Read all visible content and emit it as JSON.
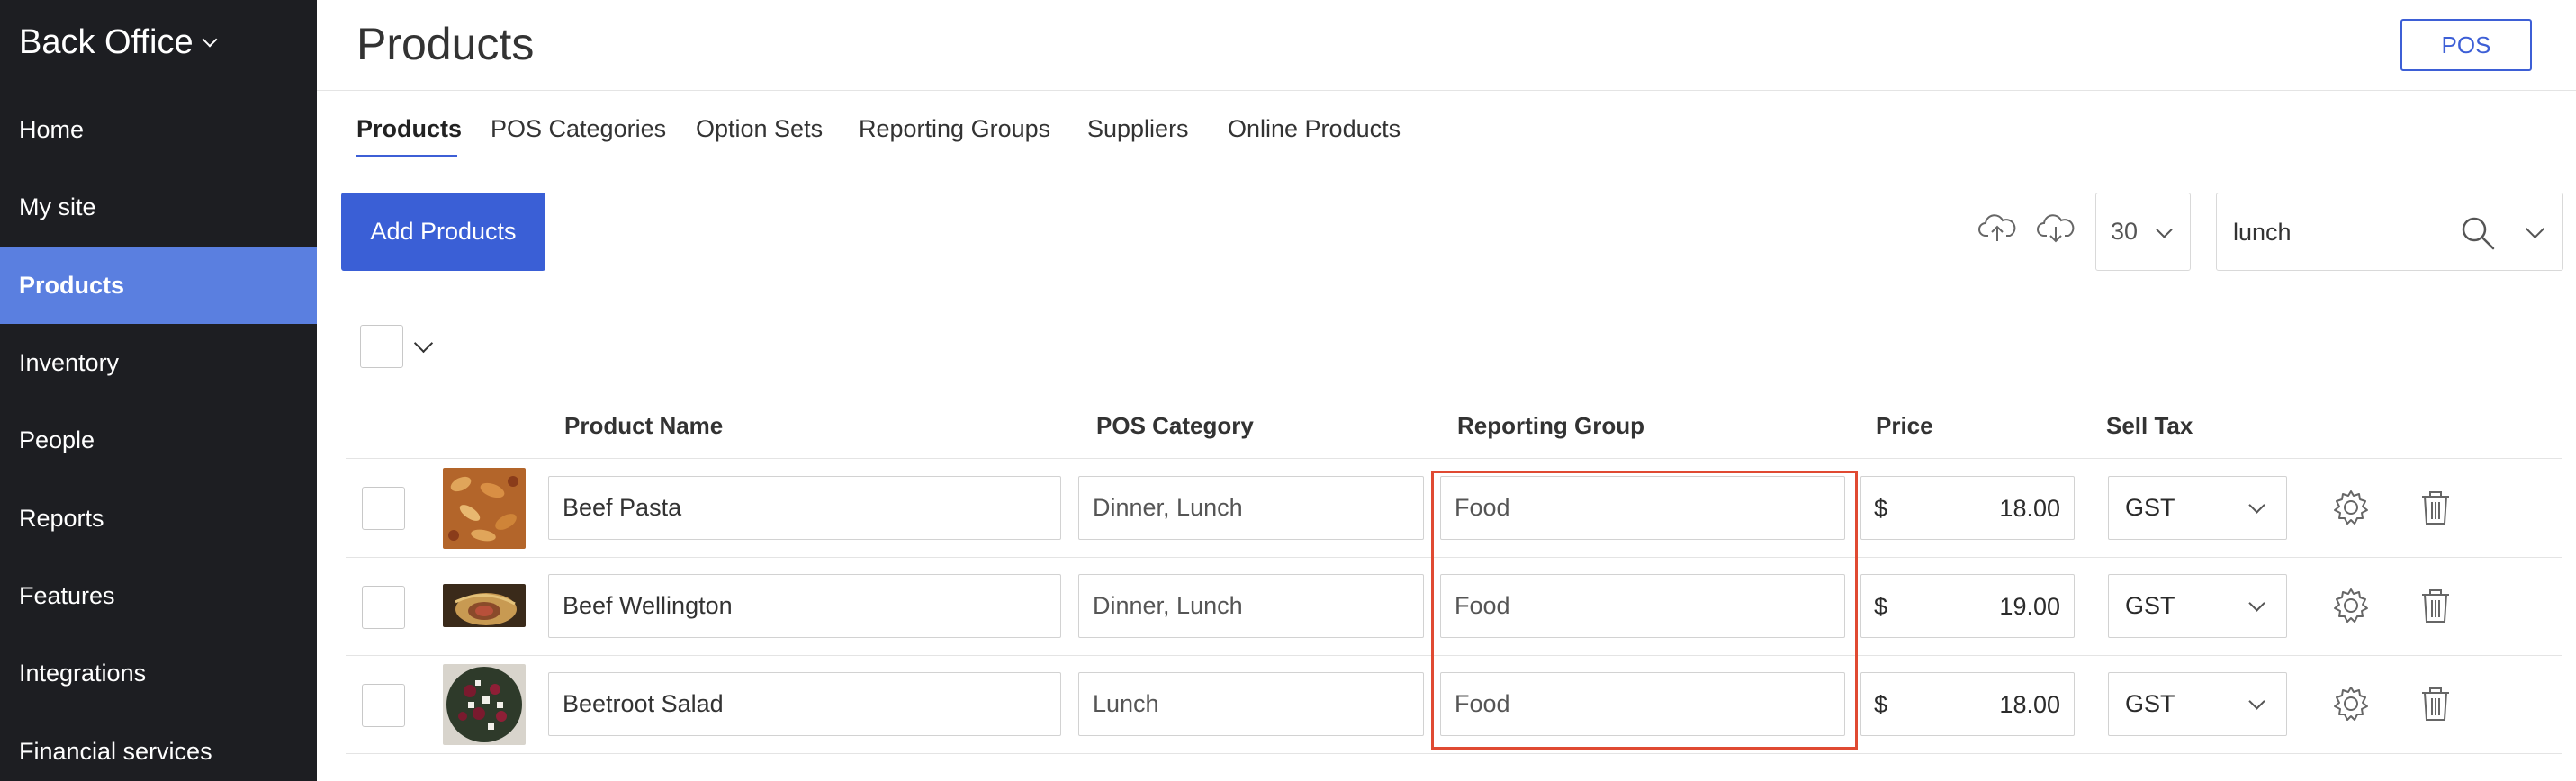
{
  "sidebar": {
    "brand": "Back Office",
    "items": [
      {
        "label": "Home"
      },
      {
        "label": "My site"
      },
      {
        "label": "Products",
        "active": true
      },
      {
        "label": "Inventory"
      },
      {
        "label": "People"
      },
      {
        "label": "Reports"
      },
      {
        "label": "Features"
      },
      {
        "label": "Integrations"
      },
      {
        "label": "Financial services"
      }
    ]
  },
  "header": {
    "title": "Products",
    "pos_button": "POS"
  },
  "tabs": [
    {
      "label": "Products",
      "active": true
    },
    {
      "label": "POS Categories"
    },
    {
      "label": "Option Sets"
    },
    {
      "label": "Reporting Groups"
    },
    {
      "label": "Suppliers"
    },
    {
      "label": "Online Products"
    }
  ],
  "toolbar": {
    "add_button": "Add Products",
    "upload_icon": "cloud-upload-icon",
    "download_icon": "cloud-download-icon",
    "per_page": "30",
    "search_value": "lunch",
    "search_placeholder": "",
    "search_icon": "search-icon"
  },
  "table": {
    "columns": [
      "Product Name",
      "POS Category",
      "Reporting Group",
      "Price",
      "Sell Tax"
    ],
    "rows": [
      {
        "name": "Beef Pasta",
        "pos_category": "Dinner, Lunch",
        "reporting_group": "Food",
        "currency": "$",
        "price": "18.00",
        "tax": "GST"
      },
      {
        "name": "Beef Wellington",
        "pos_category": "Dinner, Lunch",
        "reporting_group": "Food",
        "currency": "$",
        "price": "19.00",
        "tax": "GST"
      },
      {
        "name": "Beetroot Salad",
        "pos_category": "Lunch",
        "reporting_group": "Food",
        "currency": "$",
        "price": "18.00",
        "tax": "GST"
      }
    ]
  },
  "colors": {
    "sidebar_bg": "#1d1e22",
    "sidebar_active": "#5a7fe0",
    "accent": "#3a5fd6",
    "highlight": "#e04a32"
  }
}
